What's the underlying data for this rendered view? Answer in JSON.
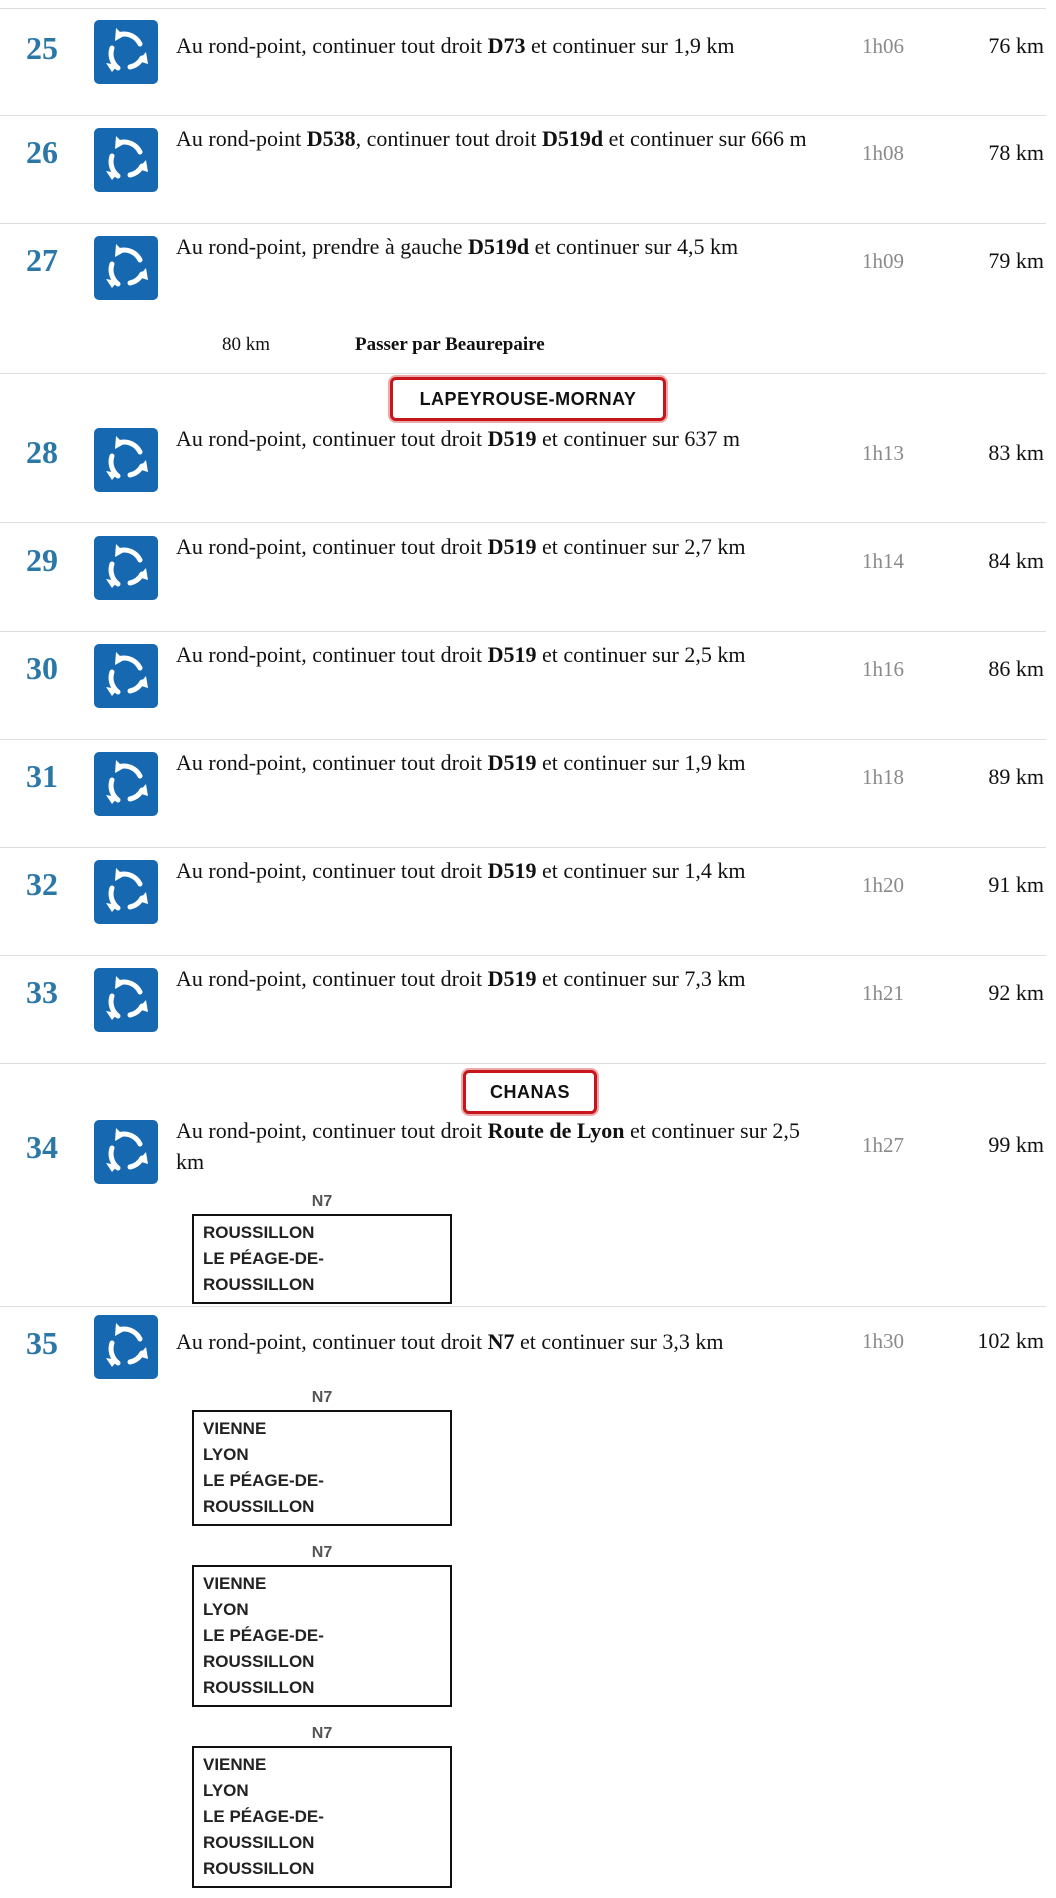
{
  "steps": [
    {
      "num": "25",
      "parts": [
        {
          "t": "Au rond-point, continuer tout droit "
        },
        {
          "t": "D73",
          "b": true
        },
        {
          "t": " et continuer sur 1,9 km"
        }
      ],
      "time": "1h06",
      "dist": "76 km"
    },
    {
      "num": "26",
      "parts": [
        {
          "t": "Au rond-point "
        },
        {
          "t": "D538",
          "b": true
        },
        {
          "t": ", continuer tout droit "
        },
        {
          "t": "D519d",
          "b": true
        },
        {
          "t": " et continuer sur 666 m"
        }
      ],
      "time": "1h08",
      "dist": "78 km"
    },
    {
      "num": "27",
      "parts": [
        {
          "t": "Au rond-point, prendre à gauche "
        },
        {
          "t": "D519d",
          "b": true
        },
        {
          "t": " et continuer sur 4,5 km"
        }
      ],
      "time": "1h09",
      "dist": "79 km"
    },
    {
      "num": "28",
      "parts": [
        {
          "t": "Au rond-point, continuer tout droit "
        },
        {
          "t": "D519",
          "b": true
        },
        {
          "t": " et continuer sur 637 m"
        }
      ],
      "time": "1h13",
      "dist": "83 km"
    },
    {
      "num": "29",
      "parts": [
        {
          "t": "Au rond-point, continuer tout droit "
        },
        {
          "t": "D519",
          "b": true
        },
        {
          "t": " et continuer sur 2,7 km"
        }
      ],
      "time": "1h14",
      "dist": "84 km"
    },
    {
      "num": "30",
      "parts": [
        {
          "t": "Au rond-point, continuer tout droit "
        },
        {
          "t": "D519",
          "b": true
        },
        {
          "t": " et continuer sur 2,5 km"
        }
      ],
      "time": "1h16",
      "dist": "86 km"
    },
    {
      "num": "31",
      "parts": [
        {
          "t": "Au rond-point, continuer tout droit "
        },
        {
          "t": "D519",
          "b": true
        },
        {
          "t": " et continuer sur 1,9 km"
        }
      ],
      "time": "1h18",
      "dist": "89 km"
    },
    {
      "num": "32",
      "parts": [
        {
          "t": "Au rond-point, continuer tout droit "
        },
        {
          "t": "D519",
          "b": true
        },
        {
          "t": " et continuer sur 1,4 km"
        }
      ],
      "time": "1h20",
      "dist": "91 km"
    },
    {
      "num": "33",
      "parts": [
        {
          "t": "Au rond-point, continuer tout droit "
        },
        {
          "t": "D519",
          "b": true
        },
        {
          "t": " et continuer sur 7,3 km"
        }
      ],
      "time": "1h21",
      "dist": "92 km"
    },
    {
      "num": "34",
      "parts": [
        {
          "t": "Au rond-point, continuer tout droit "
        },
        {
          "t": "Route de Lyon",
          "b": true
        },
        {
          "t": " et continuer sur 2,5 km"
        }
      ],
      "time": "1h27",
      "dist": "99 km"
    },
    {
      "num": "35",
      "parts": [
        {
          "t": "Au rond-point, continuer tout droit "
        },
        {
          "t": "N7",
          "b": true
        },
        {
          "t": " et continuer sur 3,3 km"
        }
      ],
      "time": "1h30",
      "dist": "102 km"
    }
  ],
  "pass": {
    "km": "80 km",
    "label": "Passer par Beaurepaire"
  },
  "town_signs": {
    "lapeyrouse": "LAPEYROUSE-MORNAY",
    "chanas": "CHANAS"
  },
  "direction_signs": [
    {
      "road": "N7",
      "lines": [
        "ROUSSILLON",
        "LE PÉAGE-DE-",
        "ROUSSILLON"
      ]
    },
    {
      "road": "N7",
      "lines": [
        "VIENNE",
        "LYON",
        "LE PÉAGE-DE-",
        "ROUSSILLON"
      ]
    },
    {
      "road": "N7",
      "lines": [
        "VIENNE",
        "LYON",
        "LE PÉAGE-DE-",
        "ROUSSILLON",
        "ROUSSILLON"
      ]
    },
    {
      "road": "N7",
      "lines": [
        "VIENNE",
        "LYON",
        "LE PÉAGE-DE-",
        "ROUSSILLON",
        "ROUSSILLON"
      ]
    }
  ],
  "icons": {
    "roundabout": "roundabout-icon"
  },
  "colors": {
    "step_number": "#2b78a8",
    "icon_bg": "#1668b0",
    "town_sign_border": "#c8141b",
    "time": "#8a8a8a"
  }
}
